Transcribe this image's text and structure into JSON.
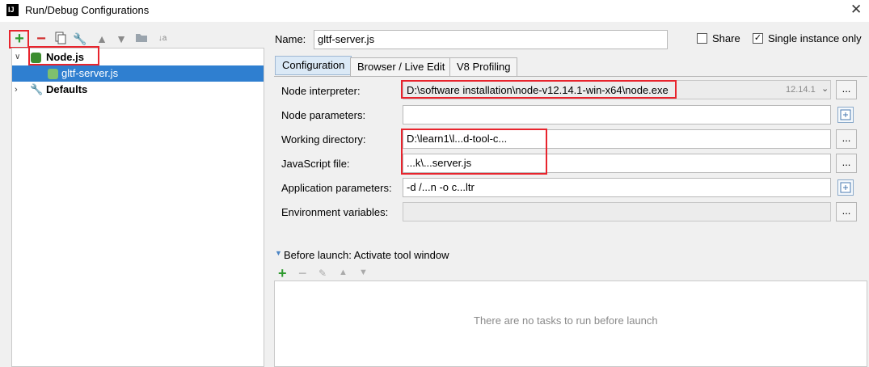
{
  "window": {
    "title": "Run/Debug Configurations",
    "logo_text": "IJ"
  },
  "toolbar": {
    "icons": [
      "add-icon",
      "remove-icon",
      "copy-icon",
      "wrench-icon",
      "move-up-icon",
      "move-down-icon",
      "folder-icon",
      "sort-icon"
    ]
  },
  "tree": {
    "nodejs_label": "Node.js",
    "child_label": "gltf-server.js",
    "defaults_label": "Defaults"
  },
  "form": {
    "name_label": "Name:",
    "name_value": "gltf-server.js",
    "share_label": "Share",
    "share_checked": false,
    "single_label": "Single instance only",
    "single_checked": true,
    "tabs": [
      "Configuration",
      "Browser / Live Edit",
      "V8 Profiling"
    ],
    "active_tab": "Configuration",
    "rows": [
      {
        "label": "Node interpreter:",
        "value": "D:\\software installation\\node-v12.14.1-win-x64\\node.exe",
        "version": "12.14.1"
      },
      {
        "label": "Node parameters:",
        "value": ""
      },
      {
        "label": "Working directory:",
        "value": "D:\\learn1\\l...d-tool-c..."
      },
      {
        "label": "JavaScript file:",
        "value": "...k\\...server.js"
      },
      {
        "label": "Application parameters:",
        "value": "-d /...n -o c...ltr"
      },
      {
        "label": "Environment variables:",
        "value": ""
      }
    ]
  },
  "before_launch": {
    "header": "Before launch: Activate tool window",
    "empty_text": "There are no tasks to run before launch"
  },
  "colors": {
    "accent_red": "#e8242d",
    "selection": "#2f7fd0",
    "node_green": "#3c8d2f"
  }
}
